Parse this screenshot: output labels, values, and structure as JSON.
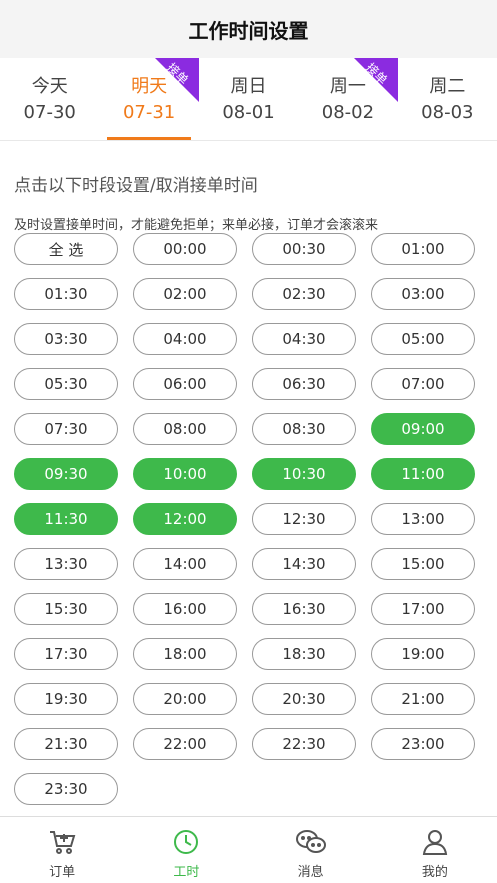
{
  "header": {
    "title": "工作时间设置"
  },
  "days": [
    {
      "name": "今天",
      "date": "07-30",
      "active": false,
      "badge": ""
    },
    {
      "name": "明天",
      "date": "07-31",
      "active": true,
      "badge": "接单"
    },
    {
      "name": "周日",
      "date": "08-01",
      "active": false,
      "badge": ""
    },
    {
      "name": "周一",
      "date": "08-02",
      "active": false,
      "badge": "接单"
    },
    {
      "name": "周二",
      "date": "08-03",
      "active": false,
      "badge": ""
    }
  ],
  "hints": {
    "main": "点击以下时段设置/取消接单时间",
    "sub": "及时设置接单时间，才能避免拒单；来单必接，订单才会滚滚来"
  },
  "slots": [
    {
      "label": "全 选",
      "selected": false
    },
    {
      "label": "00:00",
      "selected": false
    },
    {
      "label": "00:30",
      "selected": false
    },
    {
      "label": "01:00",
      "selected": false
    },
    {
      "label": "01:30",
      "selected": false
    },
    {
      "label": "02:00",
      "selected": false
    },
    {
      "label": "02:30",
      "selected": false
    },
    {
      "label": "03:00",
      "selected": false
    },
    {
      "label": "03:30",
      "selected": false
    },
    {
      "label": "04:00",
      "selected": false
    },
    {
      "label": "04:30",
      "selected": false
    },
    {
      "label": "05:00",
      "selected": false
    },
    {
      "label": "05:30",
      "selected": false
    },
    {
      "label": "06:00",
      "selected": false
    },
    {
      "label": "06:30",
      "selected": false
    },
    {
      "label": "07:00",
      "selected": false
    },
    {
      "label": "07:30",
      "selected": false
    },
    {
      "label": "08:00",
      "selected": false
    },
    {
      "label": "08:30",
      "selected": false
    },
    {
      "label": "09:00",
      "selected": true
    },
    {
      "label": "09:30",
      "selected": true
    },
    {
      "label": "10:00",
      "selected": true
    },
    {
      "label": "10:30",
      "selected": true
    },
    {
      "label": "11:00",
      "selected": true
    },
    {
      "label": "11:30",
      "selected": true
    },
    {
      "label": "12:00",
      "selected": true
    },
    {
      "label": "12:30",
      "selected": false
    },
    {
      "label": "13:00",
      "selected": false
    },
    {
      "label": "13:30",
      "selected": false
    },
    {
      "label": "14:00",
      "selected": false
    },
    {
      "label": "14:30",
      "selected": false
    },
    {
      "label": "15:00",
      "selected": false
    },
    {
      "label": "15:30",
      "selected": false
    },
    {
      "label": "16:00",
      "selected": false
    },
    {
      "label": "16:30",
      "selected": false
    },
    {
      "label": "17:00",
      "selected": false
    },
    {
      "label": "17:30",
      "selected": false
    },
    {
      "label": "18:00",
      "selected": false
    },
    {
      "label": "18:30",
      "selected": false
    },
    {
      "label": "19:00",
      "selected": false
    },
    {
      "label": "19:30",
      "selected": false
    },
    {
      "label": "20:00",
      "selected": false
    },
    {
      "label": "20:30",
      "selected": false
    },
    {
      "label": "21:00",
      "selected": false
    },
    {
      "label": "21:30",
      "selected": false
    },
    {
      "label": "22:00",
      "selected": false
    },
    {
      "label": "22:30",
      "selected": false
    },
    {
      "label": "23:00",
      "selected": false
    },
    {
      "label": "23:30",
      "selected": false
    }
  ],
  "colors": {
    "accent": "#f07a1a",
    "selected": "#3eb94b",
    "badge": "#8b2be0"
  },
  "tabs": [
    {
      "label": "订单",
      "icon": "cart-icon",
      "active": false
    },
    {
      "label": "工时",
      "icon": "clock-icon",
      "active": true
    },
    {
      "label": "消息",
      "icon": "chat-icon",
      "active": false
    },
    {
      "label": "我的",
      "icon": "user-icon",
      "active": false
    }
  ]
}
